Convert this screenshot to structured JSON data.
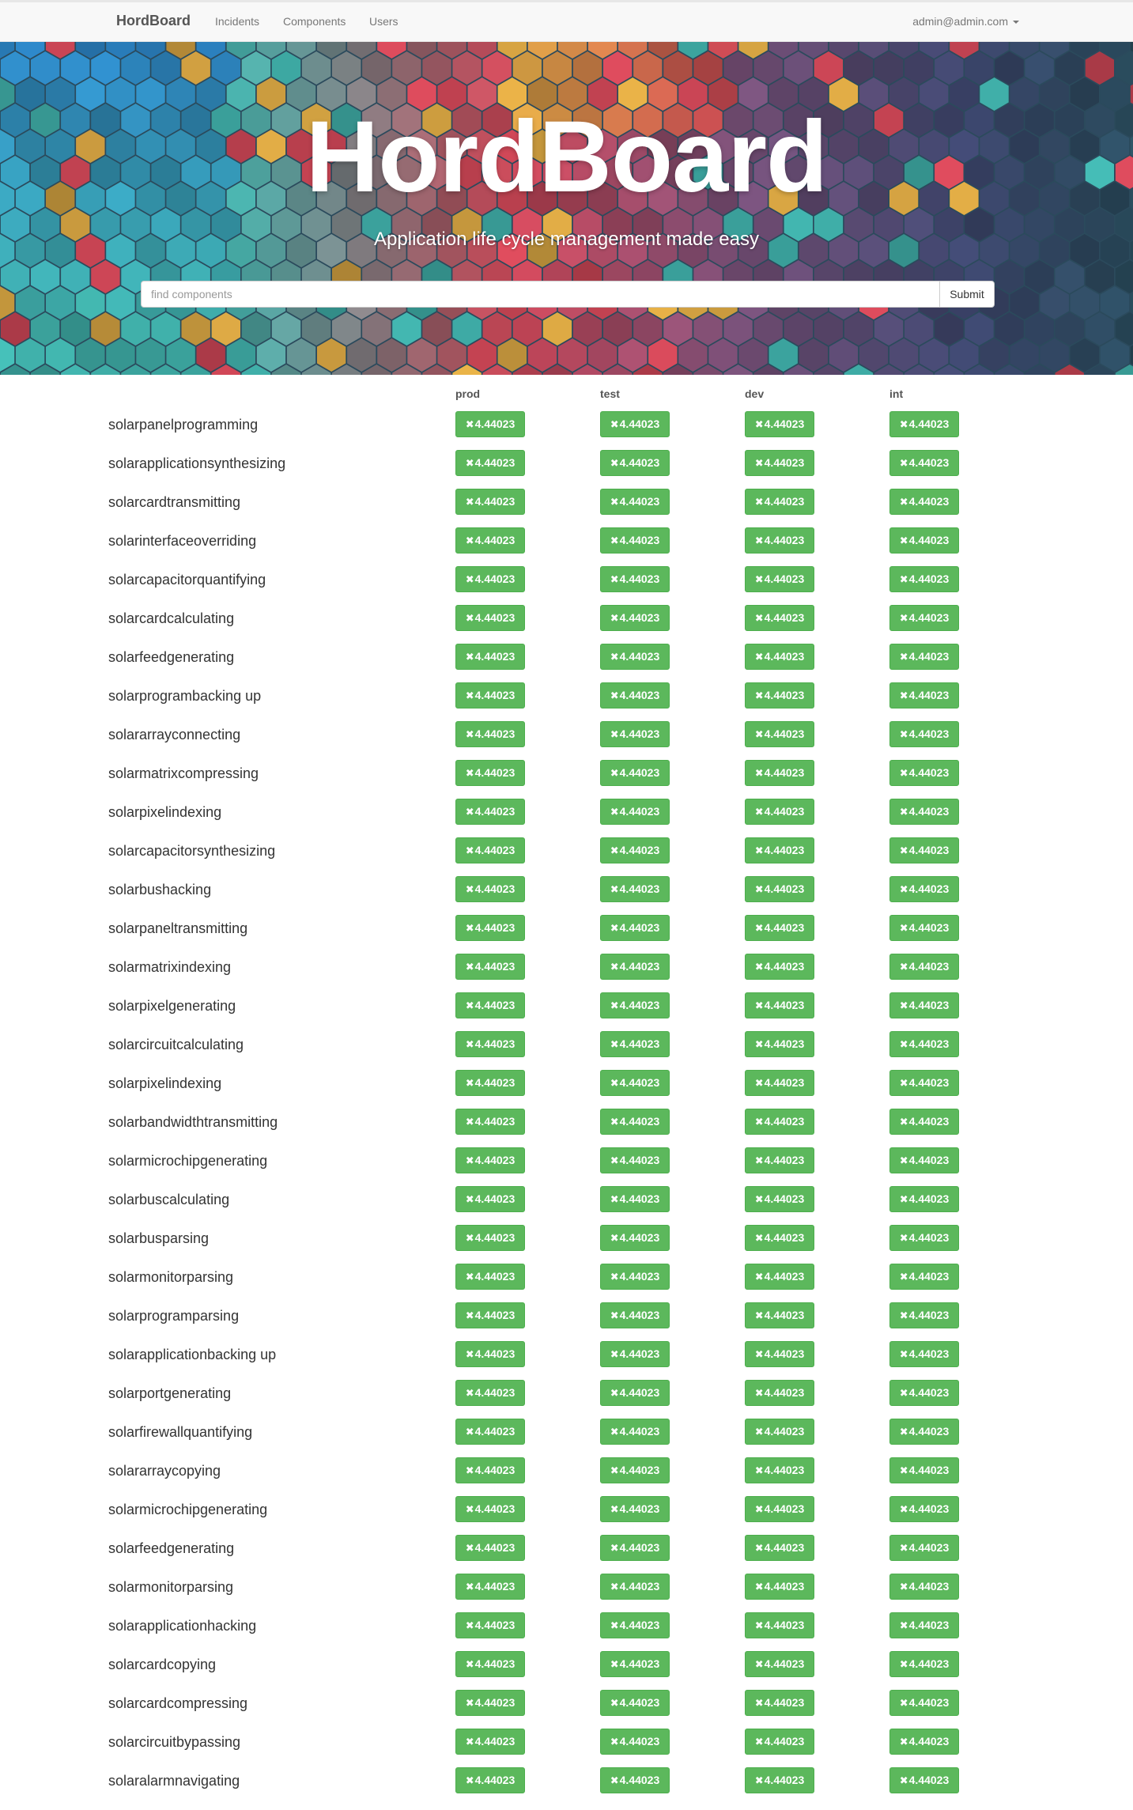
{
  "navbar": {
    "brand": "HordBoard",
    "links": [
      "Incidents",
      "Components",
      "Users"
    ],
    "user": "admin@admin.com"
  },
  "hero": {
    "title": "HordBoard",
    "subtitle": "Application life cycle management made easy",
    "search_placeholder": "find components",
    "submit_label": "Submit"
  },
  "environments": [
    "prod",
    "test",
    "dev",
    "int"
  ],
  "badge_icon": "times-icon",
  "colors": {
    "badge": "#5cb85c",
    "navbar": "#f8f8f8"
  },
  "components": [
    {
      "name": "solarpanelprogramming",
      "versions": [
        "4.44023",
        "4.44023",
        "4.44023",
        "4.44023"
      ]
    },
    {
      "name": "solarapplicationsynthesizing",
      "versions": [
        "4.44023",
        "4.44023",
        "4.44023",
        "4.44023"
      ]
    },
    {
      "name": "solarcardtransmitting",
      "versions": [
        "4.44023",
        "4.44023",
        "4.44023",
        "4.44023"
      ]
    },
    {
      "name": "solarinterfaceoverriding",
      "versions": [
        "4.44023",
        "4.44023",
        "4.44023",
        "4.44023"
      ]
    },
    {
      "name": "solarcapacitorquantifying",
      "versions": [
        "4.44023",
        "4.44023",
        "4.44023",
        "4.44023"
      ]
    },
    {
      "name": "solarcardcalculating",
      "versions": [
        "4.44023",
        "4.44023",
        "4.44023",
        "4.44023"
      ]
    },
    {
      "name": "solarfeedgenerating",
      "versions": [
        "4.44023",
        "4.44023",
        "4.44023",
        "4.44023"
      ]
    },
    {
      "name": "solarprogrambacking up",
      "versions": [
        "4.44023",
        "4.44023",
        "4.44023",
        "4.44023"
      ]
    },
    {
      "name": "solararrayconnecting",
      "versions": [
        "4.44023",
        "4.44023",
        "4.44023",
        "4.44023"
      ]
    },
    {
      "name": "solarmatrixcompressing",
      "versions": [
        "4.44023",
        "4.44023",
        "4.44023",
        "4.44023"
      ]
    },
    {
      "name": "solarpixelindexing",
      "versions": [
        "4.44023",
        "4.44023",
        "4.44023",
        "4.44023"
      ]
    },
    {
      "name": "solarcapacitorsynthesizing",
      "versions": [
        "4.44023",
        "4.44023",
        "4.44023",
        "4.44023"
      ]
    },
    {
      "name": "solarbushacking",
      "versions": [
        "4.44023",
        "4.44023",
        "4.44023",
        "4.44023"
      ]
    },
    {
      "name": "solarpaneltransmitting",
      "versions": [
        "4.44023",
        "4.44023",
        "4.44023",
        "4.44023"
      ]
    },
    {
      "name": "solarmatrixindexing",
      "versions": [
        "4.44023",
        "4.44023",
        "4.44023",
        "4.44023"
      ]
    },
    {
      "name": "solarpixelgenerating",
      "versions": [
        "4.44023",
        "4.44023",
        "4.44023",
        "4.44023"
      ]
    },
    {
      "name": "solarcircuitcalculating",
      "versions": [
        "4.44023",
        "4.44023",
        "4.44023",
        "4.44023"
      ]
    },
    {
      "name": "solarpixelindexing",
      "versions": [
        "4.44023",
        "4.44023",
        "4.44023",
        "4.44023"
      ]
    },
    {
      "name": "solarbandwidthtransmitting",
      "versions": [
        "4.44023",
        "4.44023",
        "4.44023",
        "4.44023"
      ]
    },
    {
      "name": "solarmicrochipgenerating",
      "versions": [
        "4.44023",
        "4.44023",
        "4.44023",
        "4.44023"
      ]
    },
    {
      "name": "solarbuscalculating",
      "versions": [
        "4.44023",
        "4.44023",
        "4.44023",
        "4.44023"
      ]
    },
    {
      "name": "solarbusparsing",
      "versions": [
        "4.44023",
        "4.44023",
        "4.44023",
        "4.44023"
      ]
    },
    {
      "name": "solarmonitorparsing",
      "versions": [
        "4.44023",
        "4.44023",
        "4.44023",
        "4.44023"
      ]
    },
    {
      "name": "solarprogramparsing",
      "versions": [
        "4.44023",
        "4.44023",
        "4.44023",
        "4.44023"
      ]
    },
    {
      "name": "solarapplicationbacking up",
      "versions": [
        "4.44023",
        "4.44023",
        "4.44023",
        "4.44023"
      ]
    },
    {
      "name": "solarportgenerating",
      "versions": [
        "4.44023",
        "4.44023",
        "4.44023",
        "4.44023"
      ]
    },
    {
      "name": "solarfirewallquantifying",
      "versions": [
        "4.44023",
        "4.44023",
        "4.44023",
        "4.44023"
      ]
    },
    {
      "name": "solararraycopying",
      "versions": [
        "4.44023",
        "4.44023",
        "4.44023",
        "4.44023"
      ]
    },
    {
      "name": "solarmicrochipgenerating",
      "versions": [
        "4.44023",
        "4.44023",
        "4.44023",
        "4.44023"
      ]
    },
    {
      "name": "solarfeedgenerating",
      "versions": [
        "4.44023",
        "4.44023",
        "4.44023",
        "4.44023"
      ]
    },
    {
      "name": "solarmonitorparsing",
      "versions": [
        "4.44023",
        "4.44023",
        "4.44023",
        "4.44023"
      ]
    },
    {
      "name": "solarapplicationhacking",
      "versions": [
        "4.44023",
        "4.44023",
        "4.44023",
        "4.44023"
      ]
    },
    {
      "name": "solarcardcopying",
      "versions": [
        "4.44023",
        "4.44023",
        "4.44023",
        "4.44023"
      ]
    },
    {
      "name": "solarcardcompressing",
      "versions": [
        "4.44023",
        "4.44023",
        "4.44023",
        "4.44023"
      ]
    },
    {
      "name": "solarcircuitbypassing",
      "versions": [
        "4.44023",
        "4.44023",
        "4.44023",
        "4.44023"
      ]
    },
    {
      "name": "solaralarmnavigating",
      "versions": [
        "4.44023",
        "4.44023",
        "4.44023",
        "4.44023"
      ]
    }
  ]
}
